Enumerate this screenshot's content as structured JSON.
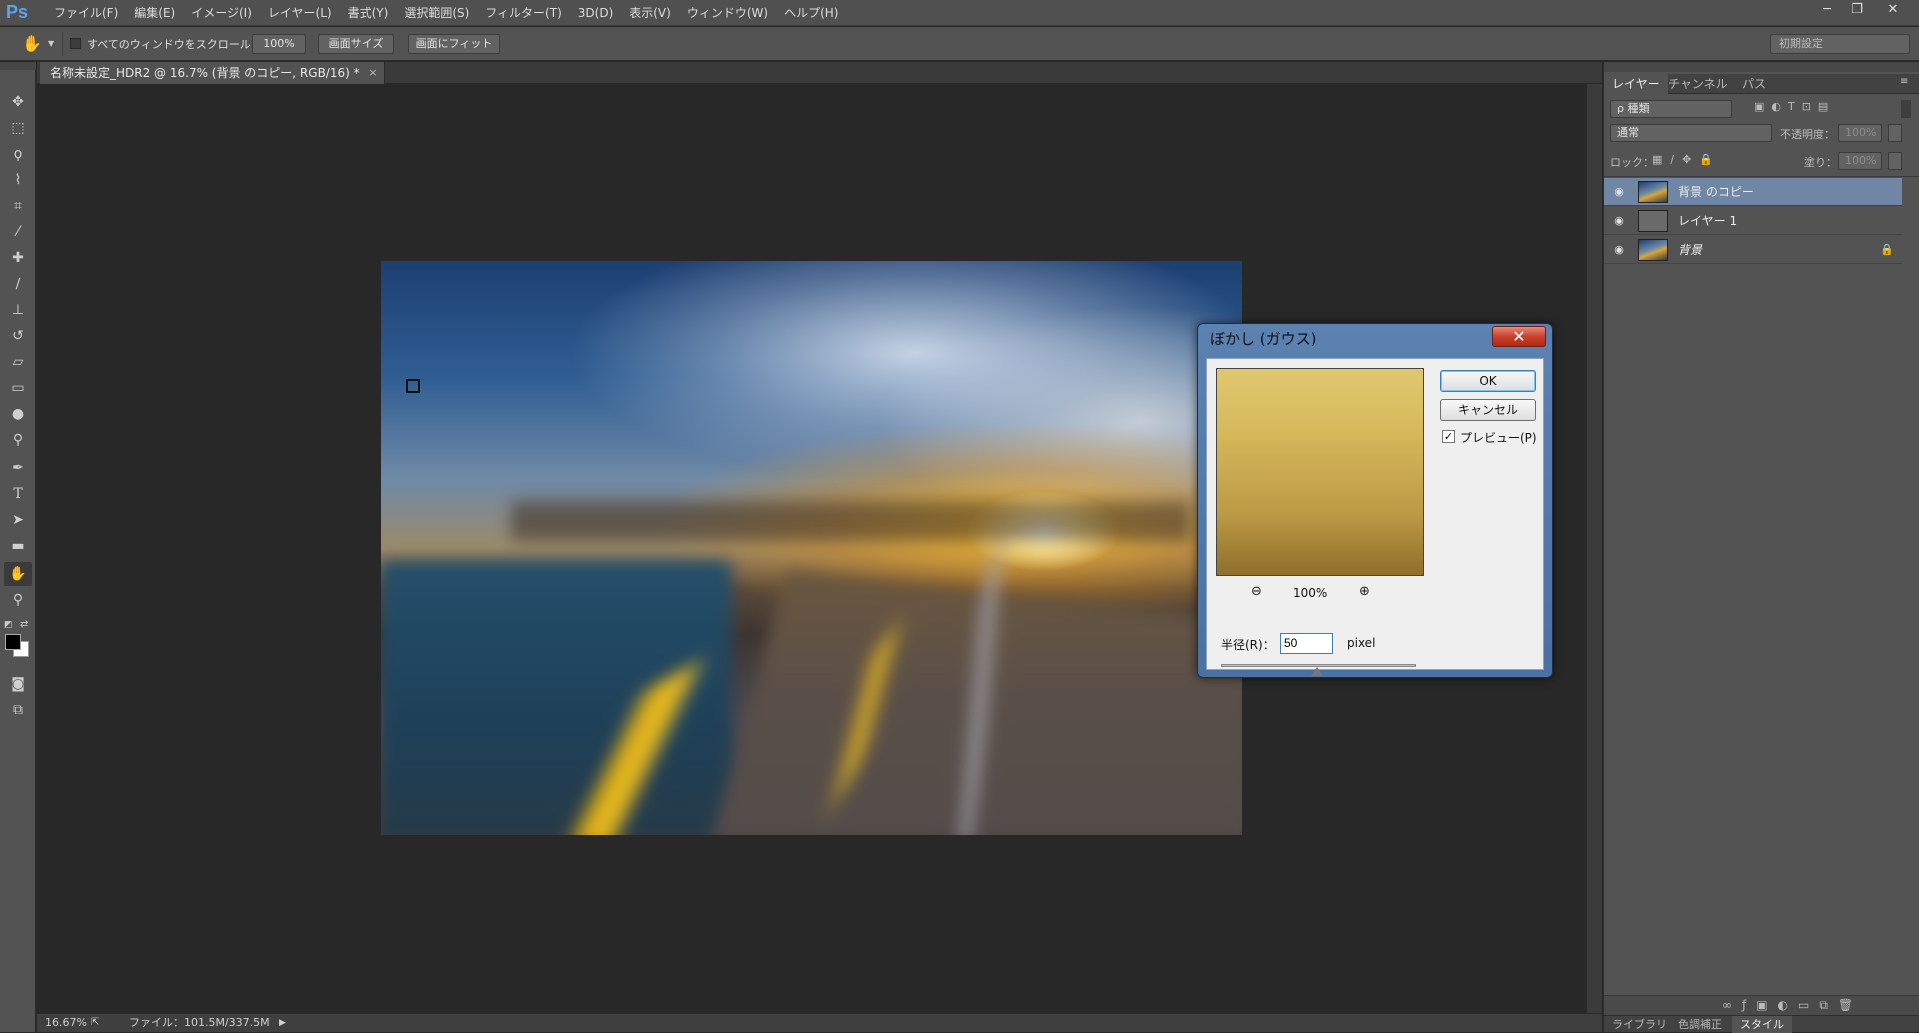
{
  "app": {
    "logo": "Ps"
  },
  "menu": [
    "ファイル(F)",
    "編集(E)",
    "イメージ(I)",
    "レイヤー(L)",
    "書式(Y)",
    "選択範囲(S)",
    "フィルター(T)",
    "3D(D)",
    "表示(V)",
    "ウィンドウ(W)",
    "ヘルプ(H)"
  ],
  "window_controls": {
    "minimize": "─",
    "restore": "❐",
    "close": "✕"
  },
  "options_bar": {
    "scroll_all_label": "すべてのウィンドウをスクロール",
    "zoom_100": "100%",
    "fit_screen": "画面サイズ",
    "fill_screen": "画面にフィット",
    "workspace": "初期設定"
  },
  "document": {
    "tab_title": "名称未設定_HDR2 @ 16.7% (背景 のコピー, RGB/16) *",
    "close": "×"
  },
  "status": {
    "zoom": "16.67%",
    "file_info": "ファイル：101.5M/337.5M"
  },
  "layers_panel": {
    "tabs": [
      "レイヤー",
      "チャンネル",
      "パス"
    ],
    "filter_kind": "ρ 種類",
    "blend_mode": "通常",
    "opacity_label": "不透明度：",
    "opacity_value": "100%",
    "lock_label": "ロック：",
    "fill_label": "塗り：",
    "fill_value": "100%",
    "layers": [
      {
        "name": "背景 のコピー",
        "visible": true,
        "selected": true
      },
      {
        "name": "レイヤー 1",
        "visible": true,
        "selected": false
      },
      {
        "name": "背景",
        "visible": true,
        "selected": false,
        "locked": true
      }
    ],
    "bottom_tabs": [
      "ライブラリ",
      "色調補正",
      "スタイル"
    ]
  },
  "gaussian_blur_dialog": {
    "title": "ぼかし (ガウス)",
    "ok": "OK",
    "cancel": "キャンセル",
    "preview_label": "プレビュー(P)",
    "preview_checked": true,
    "zoom": "100%",
    "radius_label": "半径(R)：",
    "radius_value": "50",
    "radius_unit": "pixel"
  },
  "colors": {
    "menubar": "#505050",
    "panel": "#535353",
    "canvas": "#282828",
    "selected_layer": "#6f87a4",
    "dialog_frame": "#4a71a2"
  }
}
